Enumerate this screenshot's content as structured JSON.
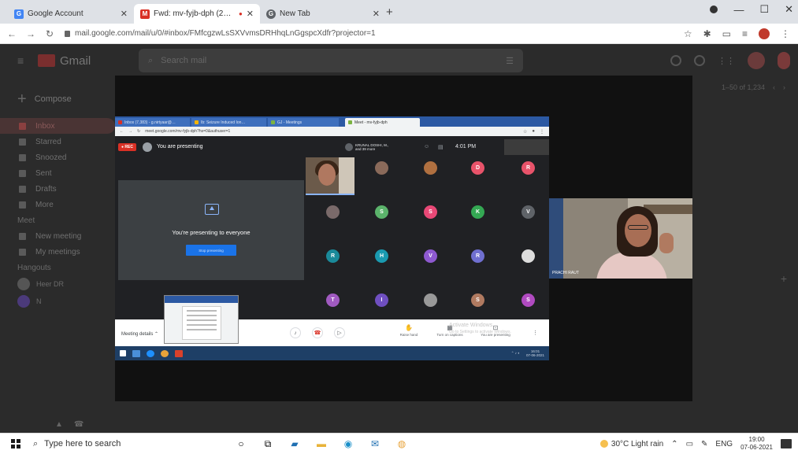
{
  "browser": {
    "tabs": [
      {
        "title": "Google Account",
        "favicon": "G",
        "color": "#4285f4"
      },
      {
        "title": "Fwd: mv-fyjb-dph (2021-07-",
        "favicon": "M",
        "color": "#d93025",
        "recording": "●"
      },
      {
        "title": "New Tab",
        "favicon": "G",
        "color": "#5f6368"
      }
    ],
    "url": "mail.google.com/mail/u/0/#inbox/FMfcgzwLsSXVvmsDRHhqLnGgspcXdfr?projector=1"
  },
  "gmail": {
    "logo_text": "Gmail",
    "search_placeholder": "Search mail",
    "compose_label": "Compose",
    "nav": [
      "Inbox",
      "Starred",
      "Snoozed",
      "Sent",
      "Drafts",
      "More"
    ],
    "meet_section": "Meet",
    "meet_items": [
      "New meeting",
      "My meetings"
    ],
    "hangouts_section": "Hangouts",
    "hangouts_users": [
      "Heer DR",
      "N"
    ],
    "pagination": "1–50 of 1,234"
  },
  "meet_share": {
    "tabs": [
      "Inbox (7,383) - g.nirtyaar@…",
      "Ib: Seizure Induced Ion…",
      "GJ - Meetings",
      "Meet - mv-fyjb-dph"
    ],
    "url": "meet.google.com/mv-fyjb-dph?hs=0&authuser=1",
    "rec_label": "● REC",
    "presenting_label": "You are presenting",
    "participants_label": "KRUNAL DOSHI, M.,",
    "participants_sub": "and 39 more",
    "time": "4:01 PM",
    "presenting_to_everyone": "You're presenting to everyone",
    "stop_presenting": "Stop presenting",
    "meeting_details": "Meeting details",
    "bottom_items": [
      "Raise hand",
      "Turn on captions",
      "You are presenting"
    ],
    "watermark": [
      "Activate Windows",
      "Go to Settings to activate Windows."
    ],
    "tray_time": "16:01",
    "tray_date": "07-06-2021",
    "camera_name": "PRACHI RAUT"
  },
  "grid": [
    {
      "letter": "",
      "color": "#8a6a5a"
    },
    {
      "letter": "",
      "color": "#b07040"
    },
    {
      "letter": "D",
      "color": "#e8536a"
    },
    {
      "letter": "R",
      "color": "#e8536a"
    },
    {
      "letter": "",
      "color": "#7a6a6a"
    },
    {
      "letter": "S",
      "color": "#5bb36b"
    },
    {
      "letter": "S",
      "color": "#e84876"
    },
    {
      "letter": "K",
      "color": "#34a853"
    },
    {
      "letter": "V",
      "color": "#5f6368"
    },
    {
      "letter": "R",
      "color": "#1a8a9a"
    },
    {
      "letter": "H",
      "color": "#1a9ab0"
    },
    {
      "letter": "V",
      "color": "#8e59d0"
    },
    {
      "letter": "R",
      "color": "#6f6fd0"
    },
    {
      "letter": "",
      "color": "#dddddd"
    },
    {
      "letter": "T",
      "color": "#a05ac0"
    },
    {
      "letter": "I",
      "color": "#6f4fc0"
    },
    {
      "letter": "",
      "color": "#999999"
    },
    {
      "letter": "S",
      "color": "#b07a60"
    },
    {
      "letter": "S",
      "color": "#b04ac0"
    }
  ],
  "taskbar": {
    "search_placeholder": "Type here to search",
    "weather": "30°C  Light rain",
    "language": "ENG",
    "time": "19:00",
    "date": "07-06-2021"
  }
}
